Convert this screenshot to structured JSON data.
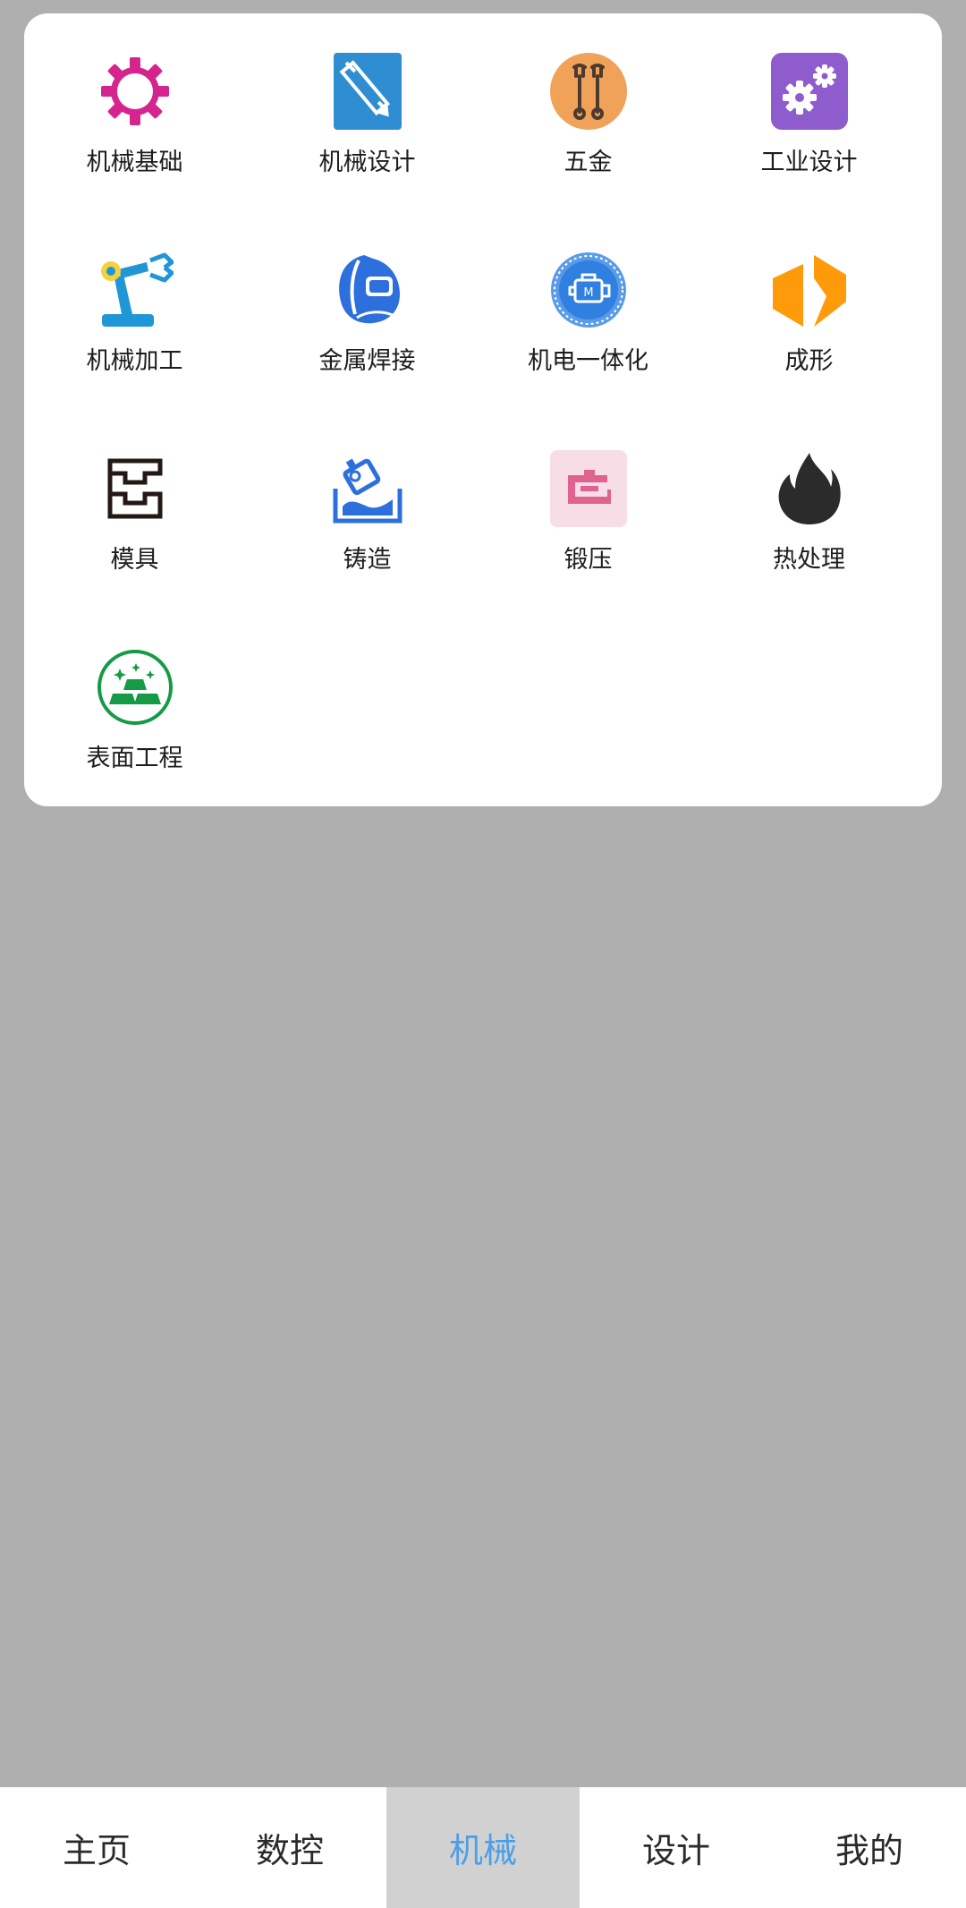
{
  "categories": [
    {
      "label": "机械基础",
      "icon": "gear-icon"
    },
    {
      "label": "机械设计",
      "icon": "pencil-ruler-icon"
    },
    {
      "label": "五金",
      "icon": "wrench-icon"
    },
    {
      "label": "工业设计",
      "icon": "gears-icon"
    },
    {
      "label": "机械加工",
      "icon": "robot-arm-icon"
    },
    {
      "label": "金属焊接",
      "icon": "welding-helmet-icon"
    },
    {
      "label": "机电一体化",
      "icon": "engine-icon"
    },
    {
      "label": "成形",
      "icon": "forming-icon"
    },
    {
      "label": "模具",
      "icon": "mold-icon"
    },
    {
      "label": "铸造",
      "icon": "casting-icon"
    },
    {
      "label": "锻压",
      "icon": "forging-press-icon"
    },
    {
      "label": "热处理",
      "icon": "flame-icon"
    },
    {
      "label": "表面工程",
      "icon": "gold-bars-icon"
    }
  ],
  "tabs": [
    {
      "label": "主页",
      "active": false
    },
    {
      "label": "数控",
      "active": false
    },
    {
      "label": "机械",
      "active": true
    },
    {
      "label": "设计",
      "active": false
    },
    {
      "label": "我的",
      "active": false
    }
  ],
  "colors": {
    "overlay": "#b0afb0",
    "active_tab_bg": "#d1d1d1",
    "active_tab_text": "#4a9fe8"
  }
}
